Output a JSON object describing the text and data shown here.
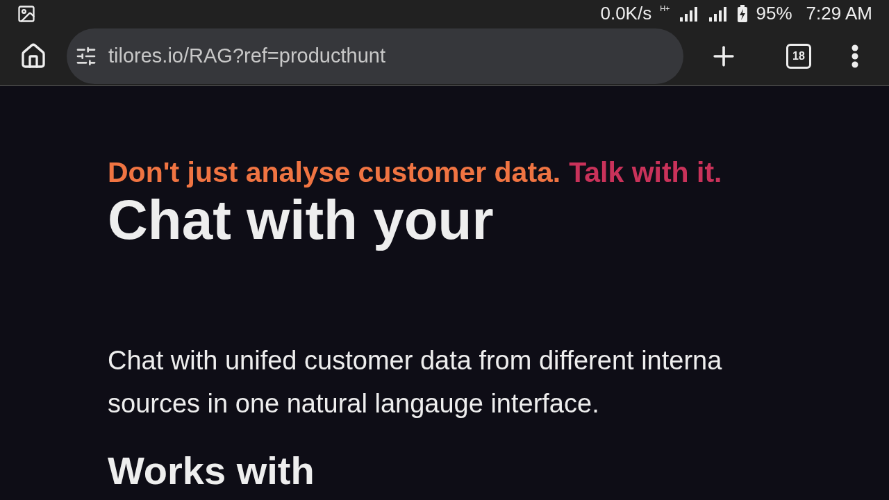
{
  "status_bar": {
    "speed": "0.0K/s",
    "network": "H+",
    "battery": "95%",
    "time": "7:29 AM"
  },
  "browser": {
    "url": "tilores.io/RAG?ref=producthunt",
    "tab_count": "18"
  },
  "page": {
    "tagline": [
      {
        "text": "Don't just analyse customer data.",
        "color": "#f07442"
      },
      {
        "text": "Talk with it.",
        "color": "#c9325a"
      }
    ],
    "heading": "Chat with your",
    "paragraph_lines": [
      "Chat with unifed customer data from different interna",
      "sources in one natural langauge interface."
    ],
    "subheading": "Works with"
  }
}
